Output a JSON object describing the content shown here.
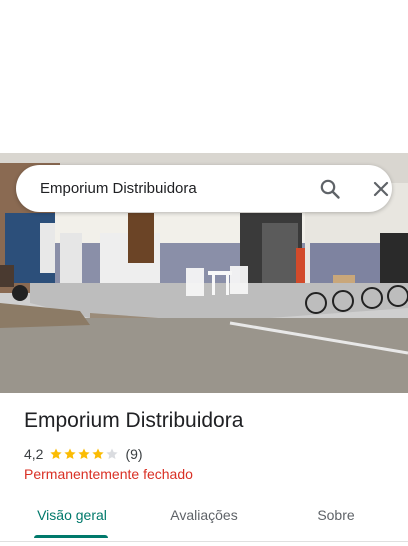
{
  "search": {
    "query": "Emporium Distribuidora",
    "search_icon": "search-icon",
    "close_icon": "close-icon"
  },
  "place": {
    "name": "Emporium Distribuidora",
    "rating": "4,2",
    "rating_stars": 4.2,
    "review_count": "(9)",
    "status": "Permanentemente fechado"
  },
  "tabs": [
    {
      "label": "Visão geral",
      "selected": true
    },
    {
      "label": "Avaliações",
      "selected": false
    },
    {
      "label": "Sobre",
      "selected": false
    }
  ],
  "colors": {
    "accent": "#00796b",
    "star": "#fbbc04",
    "closed": "#d93025"
  }
}
